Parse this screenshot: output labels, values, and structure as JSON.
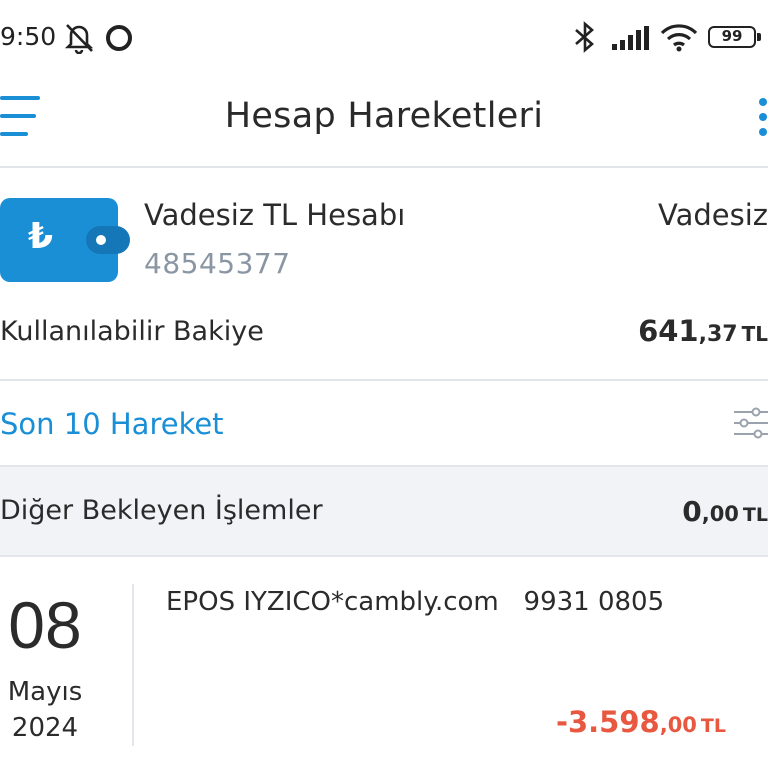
{
  "status_bar": {
    "time": "9:50",
    "battery": "99"
  },
  "header": {
    "title": "Hesap Hareketleri"
  },
  "account": {
    "currency_symbol": "₺",
    "name": "Vadesiz TL Hesabı",
    "number": "48545377",
    "type": "Vadesiz",
    "balance_label": "Kullanılabilir Bakiye",
    "balance_int": "641",
    "balance_dec": ",37",
    "balance_currency": "TL"
  },
  "section": {
    "title": "Son 10 Hareket"
  },
  "pending": {
    "label": "Diğer Bekleyen İşlemler",
    "amount_int": "0",
    "amount_dec": ",00",
    "amount_currency": "TL"
  },
  "transactions": [
    {
      "day": "08",
      "month": "Mayıs",
      "year": "2024",
      "description": "EPOS IYZICO*cambly.com   9931 0805",
      "amount_int": "-3.598",
      "amount_dec": ",00",
      "amount_currency": "TL",
      "amount_color": "#e8573f"
    }
  ],
  "colors": {
    "accent": "#1a8fd6",
    "negative": "#e8573f",
    "muted": "#8a96a3"
  },
  "icons": [
    "notifications-off-icon",
    "circle-status-icon",
    "bluetooth-icon",
    "signal-icon",
    "wifi-icon",
    "battery-icon",
    "menu-icon",
    "more-vert-icon",
    "wallet-icon",
    "filter-icon"
  ]
}
